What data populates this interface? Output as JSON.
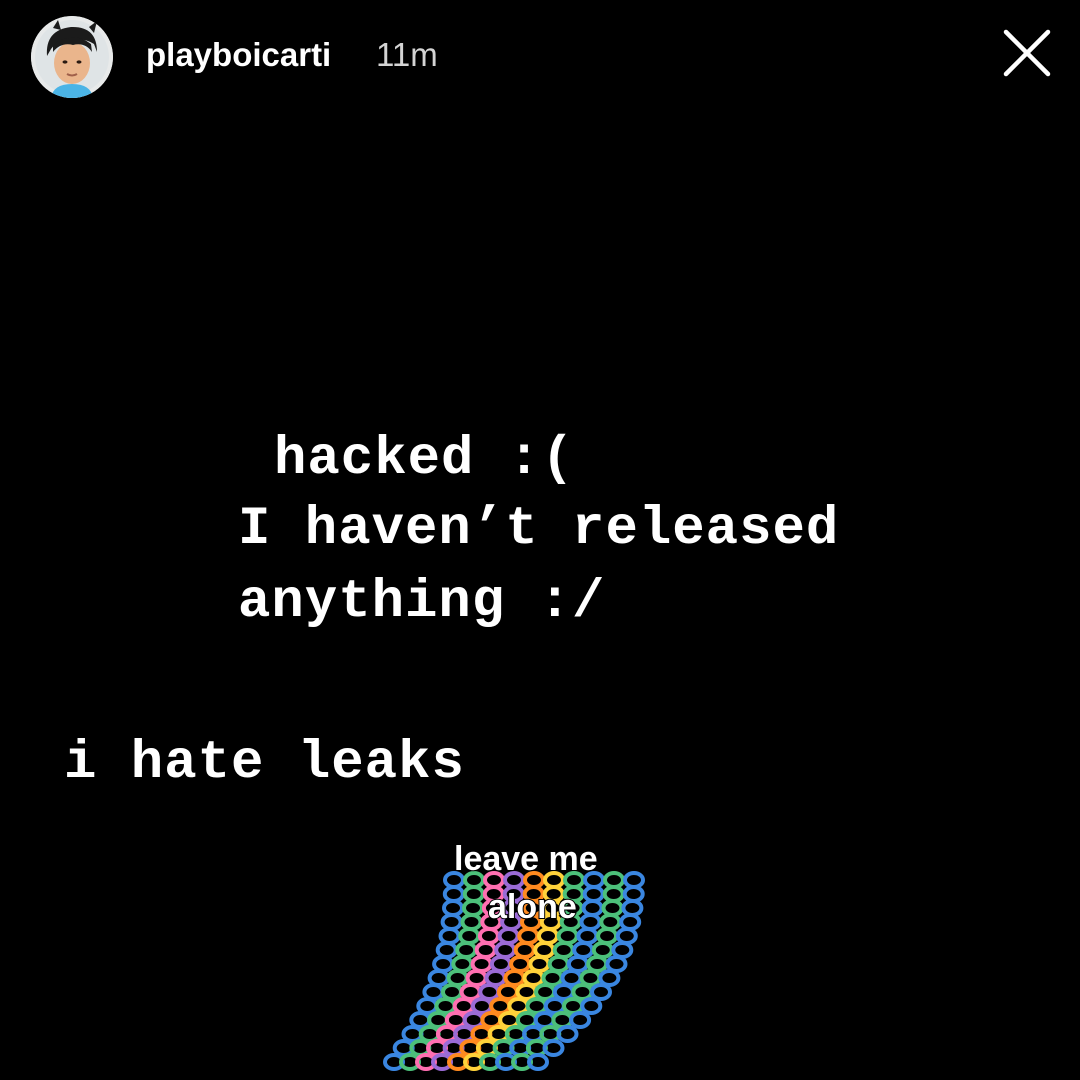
{
  "header": {
    "username": "playboicarti",
    "timestamp": "11m",
    "avatar_icon": "profile-avatar",
    "close_icon": "close-x-icon"
  },
  "story": {
    "lines": [
      "hacked :(",
      "I haven’t released",
      "anything :/",
      "i hate leaks"
    ],
    "sticker": {
      "line1": "leave me",
      "line2": "alone",
      "colors": [
        "#3a86e0",
        "#4cc07a",
        "#ff6fb1",
        "#9b6bd6",
        "#ffd23a",
        "#ff8a1f",
        "#ff4040"
      ]
    }
  }
}
